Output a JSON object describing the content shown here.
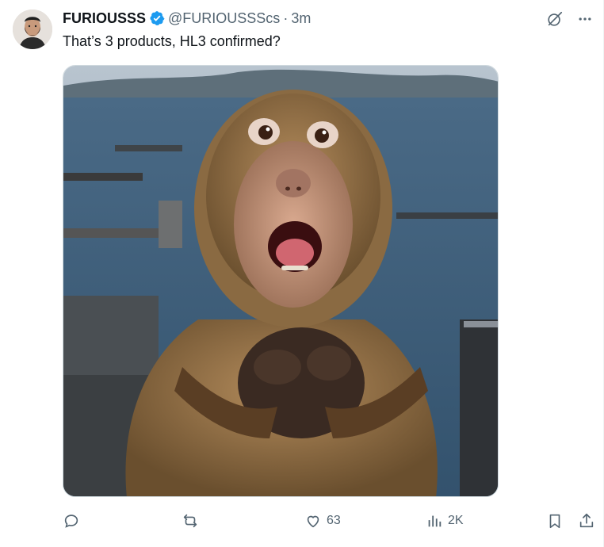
{
  "author": {
    "display_name": "FURIOUSSS",
    "handle": "@FURIOUSSScs",
    "separator": "·",
    "time": "3m",
    "verified": true,
    "avatar_icon": "bearded-man-avatar"
  },
  "tweet": {
    "text": "That’s 3 products, HL3 confirmed?",
    "media_description_icon": "shocked-macaque-photo"
  },
  "header_icons": [
    "grok-icon",
    "more-icon"
  ],
  "actions": {
    "reply": {
      "icon": "reply-icon",
      "count": ""
    },
    "retweet": {
      "icon": "retweet-icon",
      "count": ""
    },
    "like": {
      "icon": "heart-icon",
      "count": "63"
    },
    "views": {
      "icon": "views-icon",
      "count": "2K"
    },
    "bookmark": {
      "icon": "bookmark-icon"
    },
    "share": {
      "icon": "share-icon"
    }
  },
  "colors": {
    "text_primary": "#0f1419",
    "text_secondary": "#536471",
    "verified_blue": "#1d9bf0",
    "border": "#cfd9de"
  }
}
